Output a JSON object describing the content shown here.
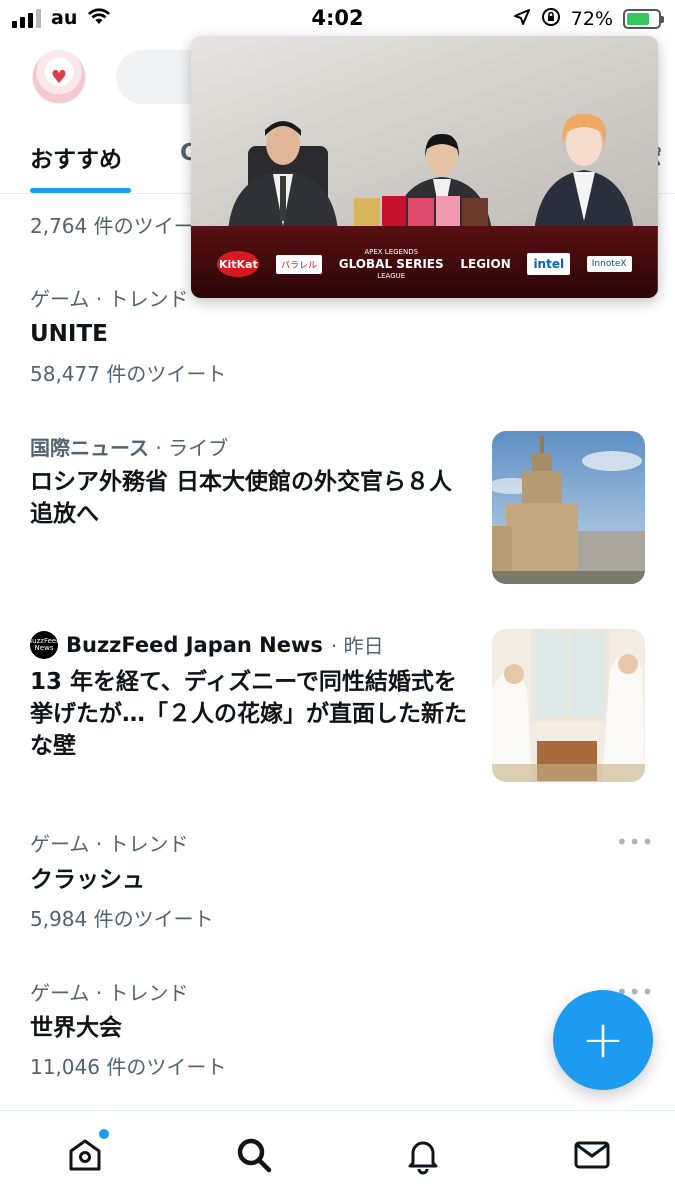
{
  "status_bar": {
    "carrier": "au",
    "time": "4:02",
    "battery_percent": "72%",
    "battery_level": 0.72
  },
  "header": {
    "avatar_icon": "profile-avatar"
  },
  "tabs": [
    {
      "label": "おすすめ",
      "selected": true
    },
    {
      "label": "C"
    },
    {
      "label": "スポ"
    }
  ],
  "trends": [
    {
      "count": "2,764 件のツイー"
    },
    {
      "category": "ゲーム · トレンド",
      "title": "UNITE",
      "count": "58,477 件のツイート"
    },
    {
      "category": "ゲーム · トレンド",
      "title": "クラッシュ",
      "count": "5,984 件のツイート"
    },
    {
      "category": "ゲーム · トレンド",
      "title": "世界大会",
      "count": "11,046 件のツイート"
    }
  ],
  "news": [
    {
      "category": "国際ニュース",
      "category_suffix": " · ライブ",
      "headline": "ロシア外務省 日本大使館の外交官ら８人追放へ",
      "thumbnail": "building-photo"
    },
    {
      "source": "BuzzFeed Japan News",
      "source_logo_text": "BuzzFeed News",
      "time": " · 昨日",
      "headline": "13 年を経て、ディズニーで同性結婚式を挙げたが…「２人の花嫁」が直面した新たな壁",
      "thumbnail": "wedding-photo"
    }
  ],
  "pip_video": {
    "logos": [
      "KitKat",
      "パラレル",
      "APEX LEGENDS",
      "GLOBAL SERIES",
      "LEAGUE",
      "LEGION",
      "intel",
      "InnoteX"
    ]
  },
  "more_label": "•••",
  "fab_label": "+",
  "colors": {
    "accent": "#1d9bf0",
    "text_primary": "#0f1419",
    "text_secondary": "#536471"
  },
  "bottom_nav": [
    "home-icon",
    "search-icon",
    "bell-icon",
    "mail-icon"
  ]
}
